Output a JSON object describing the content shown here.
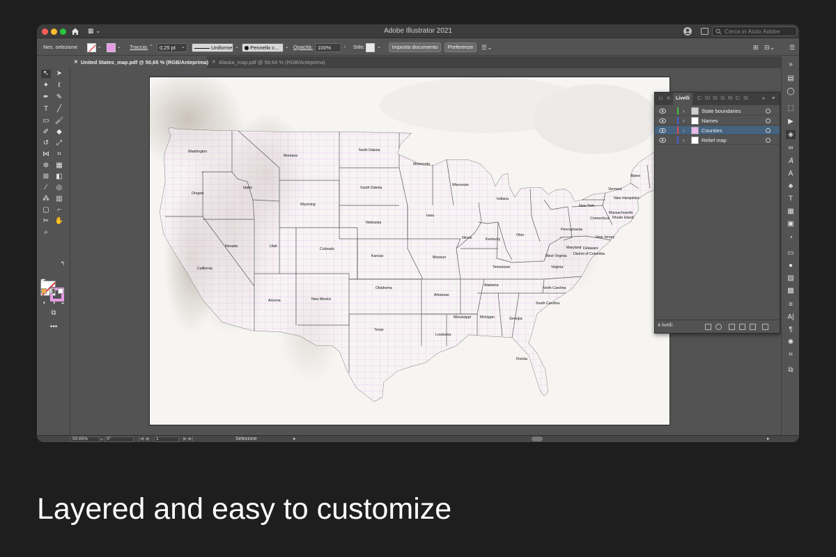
{
  "window": {
    "title": "Adobe Illustrator 2021"
  },
  "search": {
    "placeholder": "Cerca in Aiuto Adobe"
  },
  "controlbar": {
    "selection_label": "Nes. selezione",
    "stroke_label": "Traccia:",
    "stroke_weight": "0,25 pt",
    "stroke_style": "Uniforme",
    "brush": "Pennello c...",
    "opacity_label": "Opacità:",
    "opacity_value": "100%",
    "style_label": "Stile:",
    "document_setup_button": "Imposta documento",
    "preferences_button": "Preferenze"
  },
  "tabs": [
    {
      "label": "United States_map.pdf @ 50,65 % (RGB/Anteprima)",
      "active": true
    },
    {
      "label": "Alaska_map.pdf @ 59,64 % (RGB/Anteprima)",
      "active": false
    }
  ],
  "map": {
    "state_labels": [
      "Washington",
      "Oregon",
      "California",
      "Nevada",
      "Idaho",
      "Montana",
      "Wyoming",
      "Utah",
      "Colorado",
      "Arizona",
      "New Mexico",
      "North Dakota",
      "South Dakota",
      "Nebraska",
      "Kansas",
      "Oklahoma",
      "Texas",
      "Minnesota",
      "Iowa",
      "Missouri",
      "Arkansas",
      "Louisiana",
      "Wisconsin",
      "Illinois",
      "Mississippi",
      "Michigan",
      "Indiana",
      "Kentucky",
      "Tennessee",
      "Alabama",
      "Ohio",
      "Georgia",
      "Florida",
      "West Virginia",
      "Virginia",
      "North Carolina",
      "South Carolina",
      "Pennsylvania",
      "New York",
      "Maryland",
      "Delaware",
      "District of Columbia",
      "New Jersey",
      "Connecticut",
      "Rhode Island",
      "Massachusetts",
      "Vermont",
      "New Hampshire",
      "Maine"
    ]
  },
  "layers_panel": {
    "tabs": [
      "Li",
      "A:",
      "Livelli",
      "C:",
      "Gl",
      "St",
      "Si",
      "Ri",
      "C:",
      "St"
    ],
    "active_tab": "Livelli",
    "layers": [
      {
        "name": "State boundaries",
        "color": "#44c244",
        "selected": false
      },
      {
        "name": "Names",
        "color": "#4b5fd6",
        "selected": false
      },
      {
        "name": "Counties",
        "color": "#e04848",
        "selected": true
      },
      {
        "name": "Relief map",
        "color": "#4b5fd6",
        "selected": false
      }
    ],
    "count_label": "4 livelli"
  },
  "status": {
    "zoom": "50,65%",
    "rotation": "0°",
    "artboard": "1",
    "mode": "Selezione"
  },
  "caption": "Layered and easy to customize",
  "colors": {
    "background": "#1e1e1e",
    "ui_panel": "#535353",
    "counties": "#d98be6",
    "selection": "#45637f"
  }
}
